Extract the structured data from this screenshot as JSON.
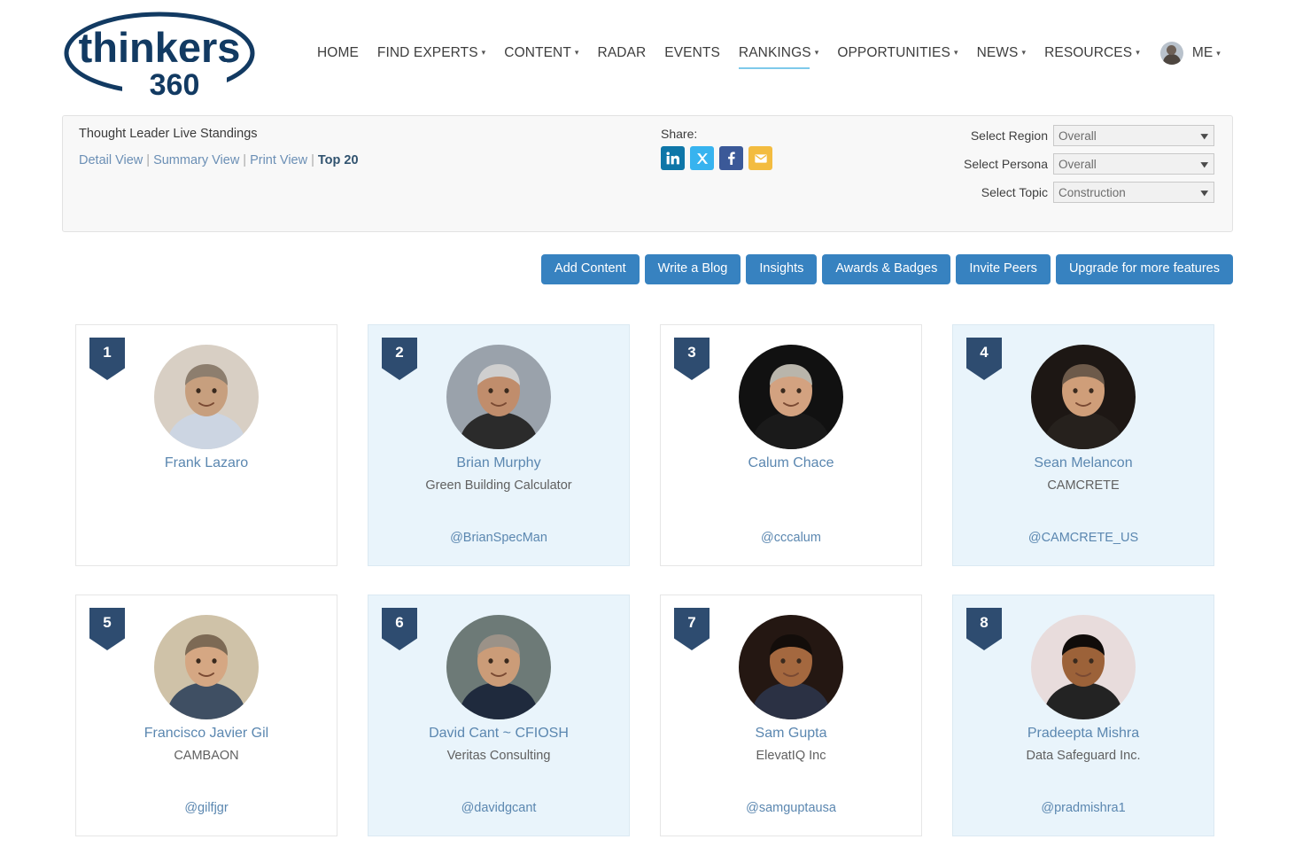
{
  "brand": {
    "name_top": "thinkers",
    "name_bottom": "360"
  },
  "nav": {
    "items": [
      {
        "label": "HOME",
        "caret": false,
        "active": false
      },
      {
        "label": "FIND EXPERTS",
        "caret": true,
        "active": false
      },
      {
        "label": "CONTENT",
        "caret": true,
        "active": false
      },
      {
        "label": "RADAR",
        "caret": false,
        "active": false
      },
      {
        "label": "EVENTS",
        "caret": false,
        "active": false
      },
      {
        "label": "RANKINGS",
        "caret": true,
        "active": true
      },
      {
        "label": "OPPORTUNITIES",
        "caret": true,
        "active": false
      },
      {
        "label": "NEWS",
        "caret": true,
        "active": false
      },
      {
        "label": "RESOURCES",
        "caret": true,
        "active": false
      }
    ],
    "me_label": "ME",
    "caret_glyph": "▾"
  },
  "filter_panel": {
    "title": "Thought Leader Live Standings",
    "views": [
      {
        "label": "Detail View",
        "bold": false
      },
      {
        "label": "Summary View",
        "bold": false
      },
      {
        "label": "Print View",
        "bold": false
      },
      {
        "label": "Top 20",
        "bold": true
      }
    ],
    "separator": "|",
    "share": {
      "label": "Share:",
      "icons": [
        {
          "name": "linkedin-icon",
          "glyph": "in",
          "color": "#0e76a8"
        },
        {
          "name": "x-twitter-icon",
          "glyph": "✕",
          "color": "#37b3ef"
        },
        {
          "name": "facebook-icon",
          "glyph": "f",
          "color": "#3b5998"
        },
        {
          "name": "email-icon",
          "glyph": "✉",
          "color": "#f3bc40"
        }
      ]
    },
    "selects": [
      {
        "label": "Select Region",
        "value": "Overall"
      },
      {
        "label": "Select Persona",
        "value": "Overall"
      },
      {
        "label": "Select Topic",
        "value": "Construction"
      }
    ],
    "chevron_glyph": "⌄"
  },
  "actions": [
    {
      "label": "Add Content"
    },
    {
      "label": "Write a Blog"
    },
    {
      "label": "Insights"
    },
    {
      "label": "Awards & Badges"
    },
    {
      "label": "Invite Peers"
    },
    {
      "label": "Upgrade for more features"
    }
  ],
  "colors": {
    "accent_blue": "#3782c0",
    "badge_navy": "#2e4c70",
    "card_shaded": "#e9f4fb",
    "link_blue": "#5b87b0",
    "nav_underline": "#7ec9ea"
  },
  "rankings": [
    {
      "rank": "1",
      "name": "Frank Lazaro",
      "company": "",
      "handle": "",
      "shaded": false,
      "avatar": {
        "bg": "#d8cfc4",
        "skin": "#c79f7e",
        "shirt": "#ccd5e2",
        "hair": "#8d7e6e"
      }
    },
    {
      "rank": "2",
      "name": "Brian Murphy",
      "company": "Green Building Calculator",
      "handle": "@BrianSpecMan",
      "shaded": true,
      "avatar": {
        "bg": "#9aa2ab",
        "skin": "#c08d6c",
        "shirt": "#2b2b2b",
        "hair": "#cfcfcf"
      }
    },
    {
      "rank": "3",
      "name": "Calum Chace",
      "company": "",
      "handle": "@cccalum",
      "shaded": false,
      "avatar": {
        "bg": "#111111",
        "skin": "#d3a280",
        "shirt": "#1a1a1a",
        "hair": "#b9b5ab"
      }
    },
    {
      "rank": "4",
      "name": "Sean Melancon",
      "company": "CAMCRETE",
      "handle": "@CAMCRETE_US",
      "shaded": true,
      "avatar": {
        "bg": "#1d1714",
        "skin": "#cf9e79",
        "shirt": "#26211d",
        "hair": "#6d5a4a"
      }
    },
    {
      "rank": "5",
      "name": "Francisco Javier Gil",
      "company": "CAMBAON",
      "handle": "@gilfjgr",
      "shaded": false,
      "avatar": {
        "bg": "#cfc2a8",
        "skin": "#d5a783",
        "shirt": "#3f4f63",
        "hair": "#7d6a55"
      }
    },
    {
      "rank": "6",
      "name": "David Cant ~ CFIOSH",
      "company": "Veritas Consulting",
      "handle": "@davidgcant",
      "shaded": true,
      "avatar": {
        "bg": "#6d7a77",
        "skin": "#cb9c78",
        "shirt": "#1f2a3d",
        "hair": "#9b9288"
      }
    },
    {
      "rank": "7",
      "name": "Sam Gupta",
      "company": "ElevatIQ Inc",
      "handle": "@samguptausa",
      "shaded": false,
      "avatar": {
        "bg": "#241712",
        "skin": "#a4683f",
        "shirt": "#2b3144",
        "hair": "#130d0a"
      }
    },
    {
      "rank": "8",
      "name": "Pradeepta Mishra",
      "company": "Data Safeguard Inc.",
      "handle": "@pradmishra1",
      "shaded": true,
      "avatar": {
        "bg": "#e8dcdc",
        "skin": "#9c6239",
        "shirt": "#232323",
        "hair": "#100c0a"
      }
    }
  ]
}
